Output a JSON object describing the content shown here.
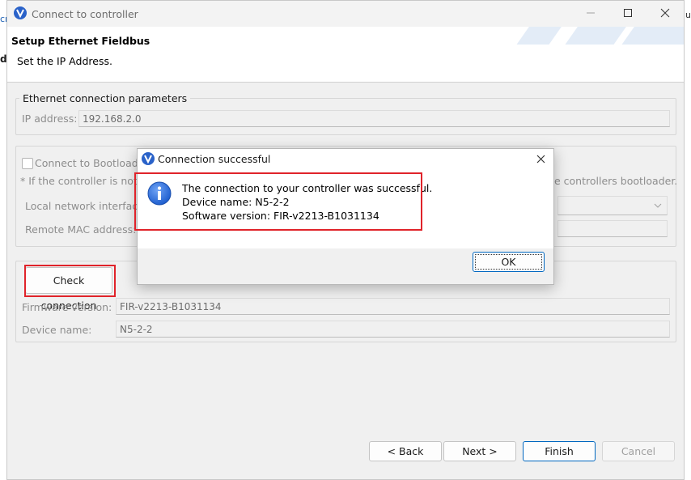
{
  "window": {
    "title": "Connect to controller",
    "header_title": "Setup Ethernet Fieldbus",
    "header_description": "Set the IP Address."
  },
  "ethernet_group": {
    "legend": "Ethernet connection parameters",
    "ip_label": "IP address:",
    "ip_value": "192.168.2.0"
  },
  "bootloader_group": {
    "checkbox_label": "Connect to Bootloader",
    "note_start": "* If the controller is not",
    "note_end": "e controllers bootloader.",
    "local_interface_label": "Local network interface",
    "remote_mac_label": "Remote MAC address:"
  },
  "check_group": {
    "check_button": "Check connection",
    "firmware_label": "Firmware version:",
    "firmware_value": "FIR-v2213-B1031134",
    "device_label": "Device name:",
    "device_value": "N5-2-2"
  },
  "footer": {
    "back": "< Back",
    "next": "Next >",
    "finish": "Finish",
    "cancel": "Cancel"
  },
  "dialog": {
    "title": "Connection successful",
    "line1": "The connection to your controller was successful.",
    "line2": "Device name: N5-2-2",
    "line3": "Software version: FIR-v2213-B1031134",
    "ok": "OK"
  },
  "left_edge": {
    "fragment1": "cr",
    "fragment2": "d"
  },
  "right_edge": {
    "fragment": "u"
  },
  "colors": {
    "accent": "#0067c0",
    "highlight_red": "#e0232a",
    "info_icon_blue": "#1f5fcf"
  },
  "icons": [
    "app-logo-icon",
    "minimize-icon",
    "maximize-icon",
    "close-icon",
    "info-icon",
    "chevron-down-icon"
  ]
}
